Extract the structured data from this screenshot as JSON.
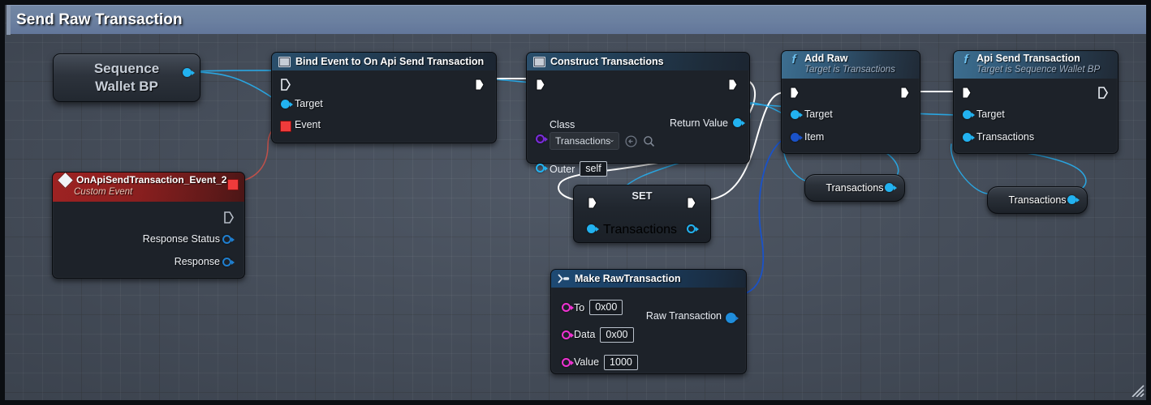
{
  "window": {
    "title": "Send Raw Transaction"
  },
  "graph": {
    "nodes": {
      "sequence_wallet_bp": {
        "title_line1": "Sequence",
        "title_line2": "Wallet BP"
      },
      "bind_event": {
        "title": "Bind Event to On Api Send Transaction",
        "icon": "square-node-icon",
        "pins": {
          "exec_in": "",
          "exec_out": "",
          "target": "Target",
          "event": "Event"
        }
      },
      "construct_transactions": {
        "title": "Construct Transactions",
        "icon": "square-node-icon",
        "pins": {
          "class_label": "Class",
          "class_value": "Transactions",
          "outer_label": "Outer",
          "outer_value": "self",
          "return_value": "Return Value"
        }
      },
      "add_raw": {
        "title": "Add Raw",
        "subtitle": "Target is Transactions",
        "icon": "function-f-icon",
        "pins": {
          "target": "Target",
          "item": "Item"
        }
      },
      "api_send_transaction": {
        "title": "Api Send Transaction",
        "subtitle": "Target is Sequence Wallet BP",
        "icon": "function-f-icon",
        "pins": {
          "target": "Target",
          "transactions": "Transactions"
        }
      },
      "custom_event": {
        "title": "OnApiSendTransaction_Event_2",
        "subtitle": "Custom Event",
        "icon": "event-diamond-icon",
        "pins": {
          "response_status": "Response Status",
          "response": "Response"
        }
      },
      "set_node": {
        "title": "SET",
        "pins": {
          "transactions": "Transactions"
        }
      },
      "make_raw_transaction": {
        "title": "Make RawTransaction",
        "icon": "make-struct-icon",
        "pins": {
          "to_label": "To",
          "to_value": "0x00",
          "data_label": "Data",
          "data_value": "0x00",
          "value_label": "Value",
          "value_value": "1000",
          "raw_transaction": "Raw Transaction"
        }
      },
      "getter_transactions_1": {
        "label": "Transactions"
      },
      "getter_transactions_2": {
        "label": "Transactions"
      }
    }
  },
  "colors": {
    "title_bar": "#6b80a0",
    "canvas": "#4a5361",
    "exec_wire": "#ffffff",
    "object_wire": "#2aa5e0",
    "struct_wire": "#1a52c8",
    "delegate_wire": "#c04a4a",
    "pin_object": "#22b2f0",
    "pin_struct": "#1a52c8",
    "pin_string": "#f032d2",
    "pin_class": "#7a2ddc",
    "pin_exec": "#ffffff",
    "pin_delegate": "#ef3b3b"
  }
}
